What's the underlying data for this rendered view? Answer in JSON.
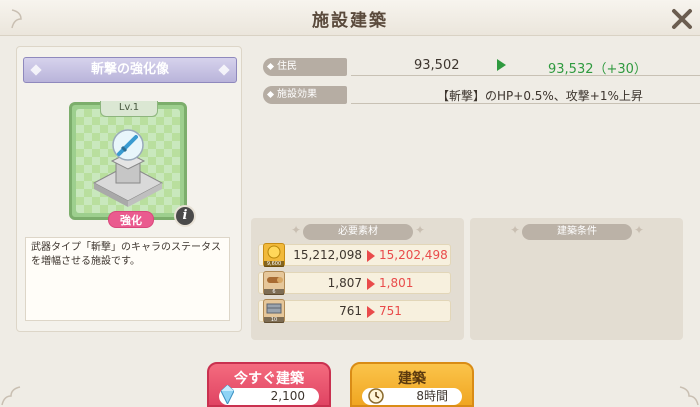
{
  "window": {
    "title": "施設建築"
  },
  "facility": {
    "name": "斬撃の強化像",
    "level": "Lv.1",
    "strengthen_label": "強化",
    "info_label": "i",
    "description": "武器タイプ「斬撃」のキャラのステータスを増幅させる施設です。"
  },
  "stats": {
    "residents": {
      "label": "住民",
      "current": "93,502",
      "after": "93,532（+30）"
    },
    "effect": {
      "label": "施設効果",
      "value": "【斬撃】のHP+0.5%、攻撃+1%上昇"
    }
  },
  "materials": {
    "header": "必要素材",
    "items": [
      {
        "icon": "gold-coin-icon",
        "icon_count": "9,600",
        "have": "15,212,098",
        "after": "15,202,498"
      },
      {
        "icon": "wood-icon",
        "icon_count": "6",
        "have": "1,807",
        "after": "1,801"
      },
      {
        "icon": "stone-icon",
        "icon_count": "10",
        "have": "761",
        "after": "751"
      }
    ]
  },
  "conditions": {
    "header": "建築条件"
  },
  "buttons": {
    "build_now": {
      "label": "今すぐ建築",
      "cost": "2,100"
    },
    "build": {
      "label": "建築",
      "time": "8時間"
    }
  },
  "colors": {
    "accent_green": "#2f9a3f",
    "accent_red": "#e94b4b",
    "build_now": "#e04463",
    "build": "#f0a622"
  }
}
